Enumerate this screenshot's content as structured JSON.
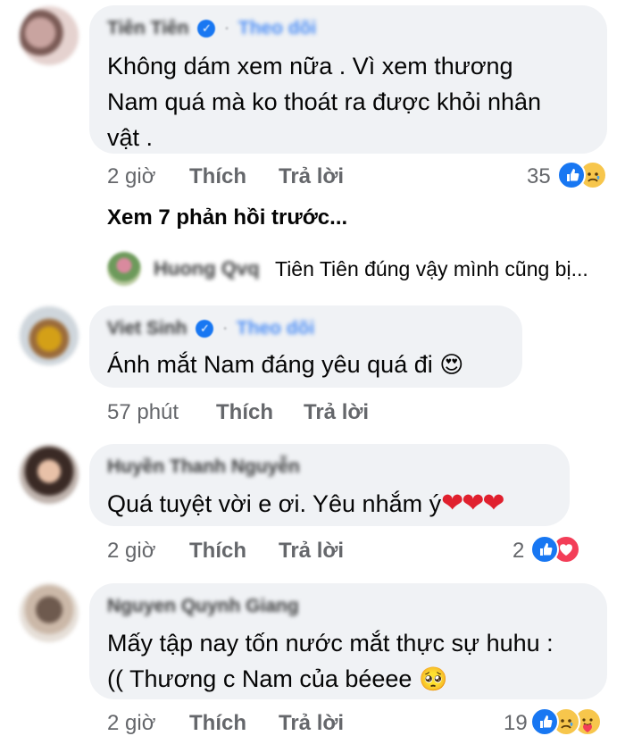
{
  "comments": [
    {
      "author": "Tiên Tiên",
      "follow_label": "Theo dõi",
      "text_lines": [
        "Không dám xem nữa . Vì xem thương",
        "Nam quá mà ko thoát ra được khỏi nhân",
        "vật ."
      ],
      "time": "2 giờ",
      "like_label": "Thích",
      "reply_label": "Trả lời",
      "reaction_count": "35",
      "reactions": [
        "like-icon",
        "sad-icon"
      ]
    },
    {
      "author": "Viet Sinh",
      "follow_label": "Theo dõi",
      "text_lines": [
        "Ánh mắt Nam đáng yêu quá đi"
      ],
      "emoji": "😍",
      "time": "57 phút",
      "like_label": "Thích",
      "reply_label": "Trả lời"
    },
    {
      "author": "Huyền Thanh Nguyễn",
      "text_lines": [
        "Quá tuyệt vời e ơi. Yêu nhắm ý"
      ],
      "emoji": "❤❤❤",
      "time": "2 giờ",
      "like_label": "Thích",
      "reply_label": "Trả lời",
      "reaction_count": "2",
      "reactions": [
        "like-icon",
        "love-icon"
      ]
    },
    {
      "author": "Nguyen Quynh Giang",
      "text_lines": [
        "Mấy tập nay tốn nước mắt thực sự huhu :",
        "(( Thương c Nam của béeee"
      ],
      "emoji": "🥺",
      "time": "2 giờ",
      "like_label": "Thích",
      "reply_label": "Trả lời",
      "reaction_count": "19",
      "reactions": [
        "like-icon",
        "sad-icon",
        "care-icon"
      ]
    }
  ],
  "view_previous": "Xem 7 phản hồi trước...",
  "reply_preview": {
    "author": "Huong Qvq",
    "text": "Tiên Tiên đúng vậy mình cũng bị..."
  },
  "colors": {
    "bubble": "#f0f2f5",
    "meta": "#65676b",
    "accent": "#1877f2",
    "follow": "#4b8df5"
  }
}
